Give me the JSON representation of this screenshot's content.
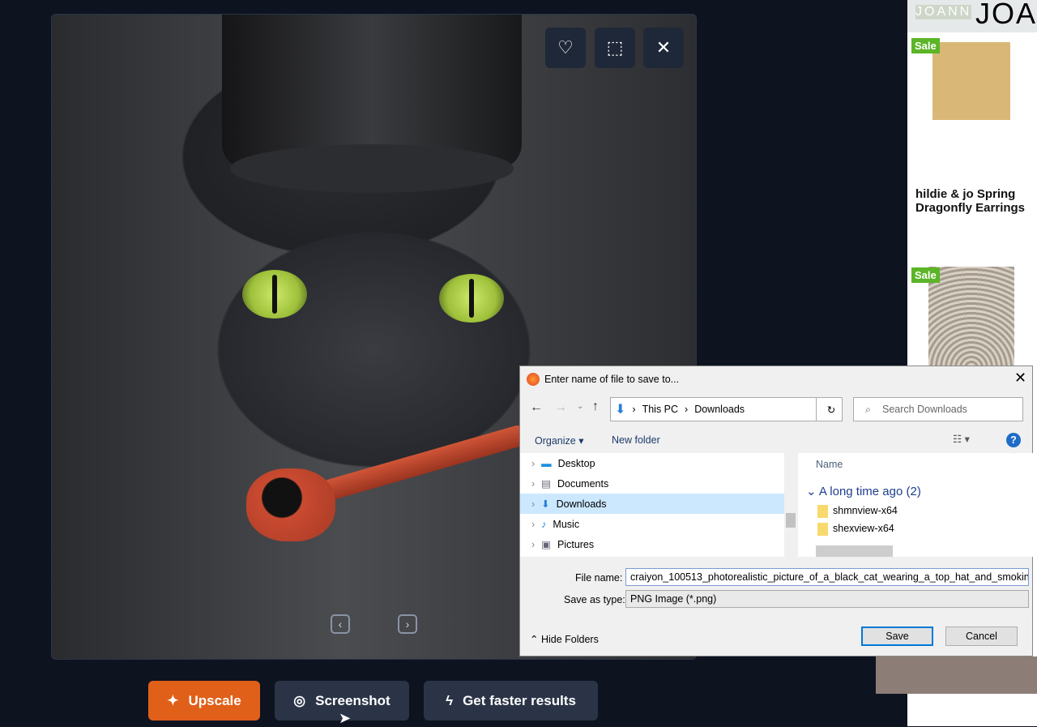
{
  "viewer": {
    "prev_icon": "‹",
    "next_icon": "›"
  },
  "actions": {
    "upscale": "Upscale",
    "screenshot": "Screenshot",
    "faster": "Get faster results"
  },
  "ad": {
    "brand": "JOANN",
    "logo": "JOA",
    "sale": "Sale",
    "product_title": "hildie & jo Spring Dragonfly Earrings"
  },
  "dialog": {
    "title": "Enter name of file to save to...",
    "path": [
      "This PC",
      "Downloads"
    ],
    "search_placeholder": "Search Downloads",
    "organize": "Organize ▾",
    "new_folder": "New folder",
    "tree": [
      "Desktop",
      "Documents",
      "Downloads",
      "Music",
      "Pictures"
    ],
    "column_name": "Name",
    "group": "A long time ago (2)",
    "files": [
      "shmnview-x64",
      "shexview-x64"
    ],
    "file_name_label": "File name:",
    "file_name": "craiyon_100513_photorealistic_picture_of_a_black_cat_wearing_a_top_hat_and_smokin",
    "type_label": "Save as type:",
    "type": "PNG Image (*.png)",
    "hide_folders": "Hide Folders",
    "save": "Save",
    "cancel": "Cancel"
  },
  "colors": {
    "upscale": "#e0601a",
    "button": "#2b3447",
    "accent": "#0078d7"
  }
}
